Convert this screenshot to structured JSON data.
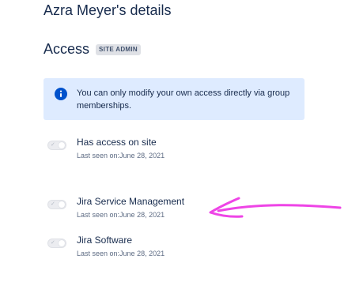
{
  "page": {
    "title": "Azra Meyer's details"
  },
  "access": {
    "heading": "Access",
    "badge": "SITE ADMIN",
    "info_icon": "info-icon",
    "info_message": "You can only modify your own access directly via group memberships.",
    "items": [
      {
        "title": "Has access on site",
        "last_seen_label": "Last seen on:",
        "last_seen_date": "June 28, 2021",
        "enabled": false,
        "toggle_icon": "check-icon"
      },
      {
        "title": "Jira Service Management",
        "last_seen_label": "Last seen on:",
        "last_seen_date": "June 28, 2021",
        "enabled": false,
        "toggle_icon": "check-icon"
      },
      {
        "title": "Jira Software",
        "last_seen_label": "Last seen on:",
        "last_seen_date": "June 28, 2021",
        "enabled": false,
        "toggle_icon": "check-icon"
      }
    ]
  },
  "annotation": {
    "arrow_color": "#ee44e6",
    "arrow_icon": "arrow-left-annotation"
  },
  "colors": {
    "text": "#172b4d",
    "subtext": "#5e6c84",
    "banner_bg": "#deebff",
    "info_icon": "#0052cc",
    "lozenge_bg": "#dfe1e6"
  }
}
